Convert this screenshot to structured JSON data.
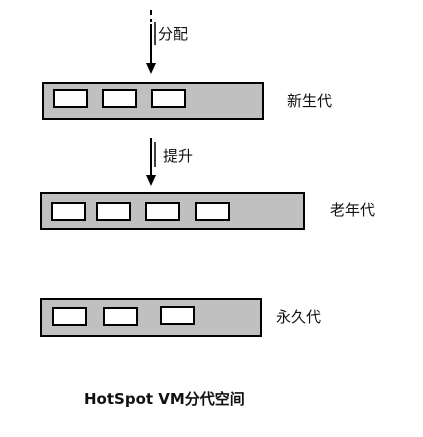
{
  "flow_labels": {
    "allocate": "分配",
    "promote": "提升"
  },
  "generations": {
    "young": {
      "label": "新生代"
    },
    "old": {
      "label": "老年代"
    },
    "permanent": {
      "label": "永久代"
    }
  },
  "caption": "HotSpot VM分代空间",
  "colors": {
    "generation_fill": "#c0c0c0",
    "object_fill": "#ffffff",
    "stroke": "#000000"
  }
}
